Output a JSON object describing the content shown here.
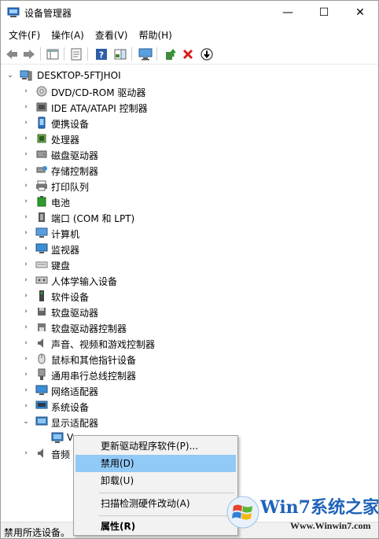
{
  "window": {
    "title": "设备管理器",
    "minimize_symbol": "—",
    "maximize_symbol": "☐",
    "close_symbol": "✕"
  },
  "menu": {
    "items": [
      "文件(F)",
      "操作(A)",
      "查看(V)",
      "帮助(H)"
    ]
  },
  "toolbar": {
    "buttons": [
      "back-arrow-icon",
      "forward-arrow-icon",
      "show-hide-console-tree-icon",
      "properties-icon",
      "help-icon",
      "action-pane-icon",
      "monitor-scan-icon",
      "update-driver-icon",
      "uninstall-icon",
      "disable-icon"
    ]
  },
  "tree": {
    "root": "DESKTOP-5FTJHOI",
    "categories": [
      {
        "label": "DVD/CD-ROM 驱动器",
        "icon": "dvd-drive-icon"
      },
      {
        "label": "IDE ATA/ATAPI 控制器",
        "icon": "ide-controller-icon"
      },
      {
        "label": "便携设备",
        "icon": "portable-device-icon"
      },
      {
        "label": "处理器",
        "icon": "processor-icon"
      },
      {
        "label": "磁盘驱动器",
        "icon": "disk-drive-icon"
      },
      {
        "label": "存储控制器",
        "icon": "storage-controller-icon"
      },
      {
        "label": "打印队列",
        "icon": "printer-icon"
      },
      {
        "label": "电池",
        "icon": "battery-icon"
      },
      {
        "label": "端口 (COM 和 LPT)",
        "icon": "port-icon"
      },
      {
        "label": "计算机",
        "icon": "computer-icon"
      },
      {
        "label": "监视器",
        "icon": "monitor-icon"
      },
      {
        "label": "键盘",
        "icon": "keyboard-icon"
      },
      {
        "label": "人体学输入设备",
        "icon": "hid-icon"
      },
      {
        "label": "软件设备",
        "icon": "software-device-icon"
      },
      {
        "label": "软盘驱动器",
        "icon": "floppy-drive-icon"
      },
      {
        "label": "软盘驱动器控制器",
        "icon": "floppy-controller-icon"
      },
      {
        "label": "声音、视频和游戏控制器",
        "icon": "sound-icon"
      },
      {
        "label": "鼠标和其他指针设备",
        "icon": "mouse-icon"
      },
      {
        "label": "通用串行总线控制器",
        "icon": "usb-icon"
      },
      {
        "label": "网络适配器",
        "icon": "network-adapter-icon"
      },
      {
        "label": "系统设备",
        "icon": "system-device-icon"
      },
      {
        "label": "显示适配器",
        "icon": "display-adapter-icon"
      }
    ],
    "child_device_partial": "V",
    "after_label_partial": "音频"
  },
  "context_menu": {
    "items": [
      "更新驱动程序软件(P)...",
      "禁用(D)",
      "卸载(U)",
      "扫描检测硬件改动(A)",
      "属性(R)"
    ],
    "highlighted_index": 1
  },
  "status": {
    "text": "禁用所选设备。"
  },
  "watermark": {
    "brand": "Win7系统之家",
    "url": "Www.Winwin7.com"
  },
  "colors": {
    "highlight": "#91c9f7",
    "accent_blue": "#1f63b8",
    "delete_red": "#d81e1e",
    "status_bg": "#f0f0f0"
  }
}
